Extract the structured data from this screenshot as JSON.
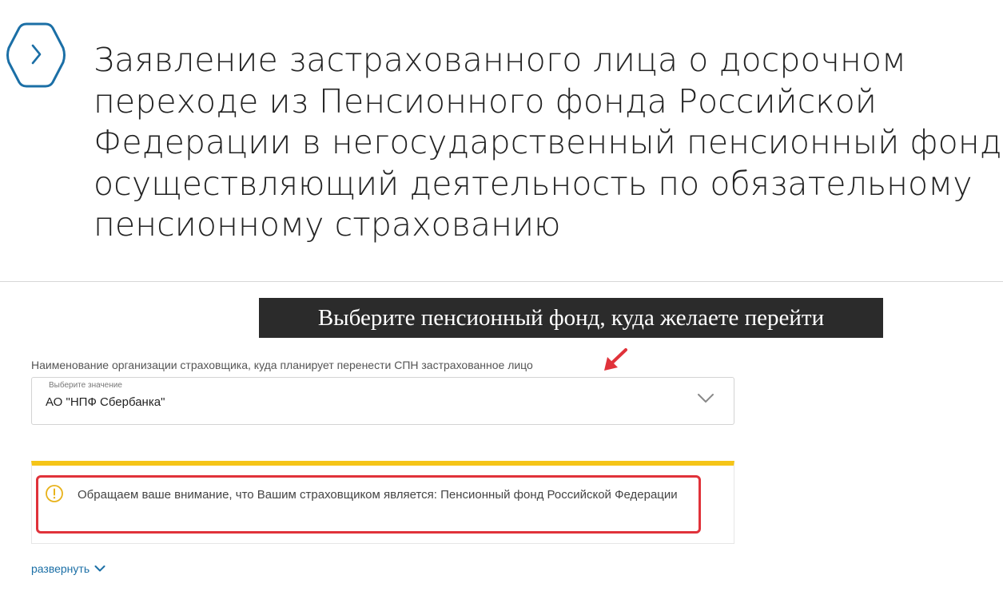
{
  "header": {
    "title_lines": [
      "Заявление застрахованного лица о досрочном",
      "переходе из Пенсионного фонда Российской",
      "Федерации в негосударственный пенсионный фонд,",
      "осуществляющий деятельность по обязательному",
      "пенсионному страхованию"
    ],
    "back_icon": "chevron-right-icon"
  },
  "hint": {
    "text": "Выберите пенсионный фонд, куда желаете перейти"
  },
  "field": {
    "label": "Наименование организации страховщика, куда планирует перенести СПН застрахованное лицо",
    "caption": "Выберите значение",
    "value": "АО \"НПФ Сбербанка\"",
    "chevron_icon": "chevron-down-icon"
  },
  "notice": {
    "text": "Обращаем ваше внимание, что Вашим страховщиком является: Пенсионный фонд Российской Федерации",
    "icon": "warning-icon"
  },
  "expand": {
    "label": "развернуть"
  },
  "colors": {
    "accent": "#1b6fa6",
    "notice_bar": "#f5c518",
    "highlight": "#e0323a",
    "hint_bg": "#2b2b2b"
  }
}
